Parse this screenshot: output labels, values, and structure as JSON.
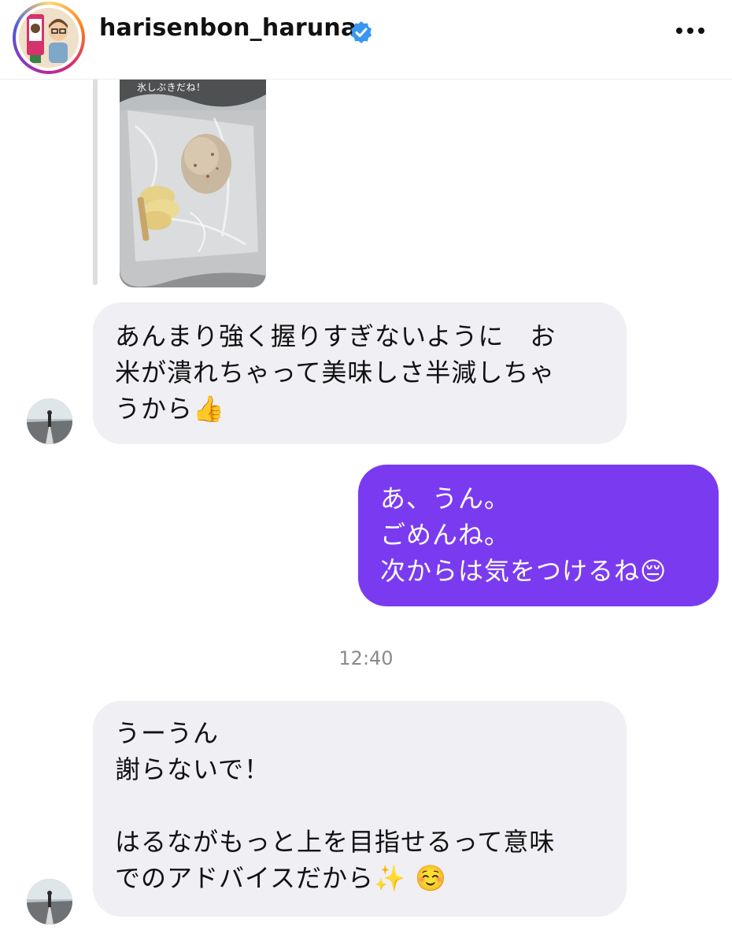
{
  "header": {
    "username": "harisenbon_haruna",
    "verified_icon": "verified-badge-icon",
    "more_icon": "more-options-icon",
    "brand_color": "#3897f0"
  },
  "shared_image": {
    "caption": "氷しぶきだね！"
  },
  "messages": [
    {
      "sender": "other",
      "lines": [
        "あんまり強く握りすぎないように　お",
        "米が潰れちゃって美味しさ半減しちゃ",
        "うから👍"
      ]
    },
    {
      "sender": "me",
      "lines": [
        "あ、うん。",
        "ごめんね。",
        "次からは気をつけるね😔"
      ]
    },
    {
      "sender": "other",
      "lines": [
        "うーうん",
        "謝らないで！",
        "",
        "はるながもっと上を目指せるって意味",
        "でのアドバイスだから✨ ☺️"
      ]
    }
  ],
  "timestamp": "12:40",
  "colors": {
    "outgoing_bubble": "#7a3bf0",
    "incoming_bubble": "#efeff4"
  }
}
